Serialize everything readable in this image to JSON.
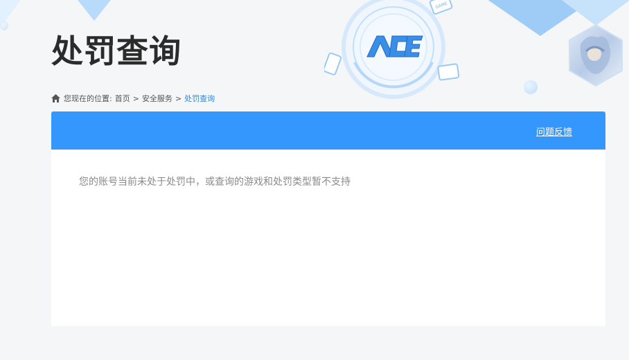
{
  "page": {
    "title": "处罚查询"
  },
  "breadcrumb": {
    "prefix": "您现在的位置:",
    "items": [
      "首页",
      "安全服务",
      "处罚查询"
    ],
    "separator": ">"
  },
  "panel": {
    "feedback_label": "问题反馈",
    "message": "您的账号当前未处于处罚中，或查询的游戏和处罚类型暂不支持"
  },
  "logo": {
    "text": "ACE",
    "badge_text": "GAME"
  },
  "colors": {
    "accent": "#3497fe",
    "link": "#2f87db",
    "title": "#2b2b2b",
    "background": "#f5f6f7"
  }
}
